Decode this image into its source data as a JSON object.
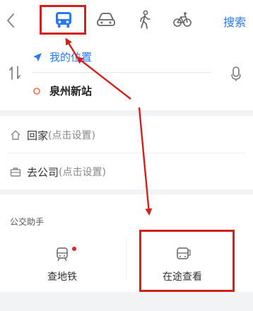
{
  "header": {
    "back_icon": "chevron-left-icon",
    "modes": [
      {
        "name": "bus",
        "icon": "bus-icon",
        "active": true
      },
      {
        "name": "car",
        "icon": "car-icon",
        "active": false
      },
      {
        "name": "walk",
        "icon": "walk-icon",
        "active": false
      },
      {
        "name": "bike",
        "icon": "bike-icon",
        "active": false
      }
    ],
    "search_label": "搜索"
  },
  "route": {
    "origin_label": "我的位置",
    "destination_label": "泉州新站",
    "swap_icon": "swap-icon",
    "voice_icon": "microphone-icon"
  },
  "quick": {
    "home_label": "回家",
    "home_hint": "(点击设置)",
    "work_label": "去公司",
    "work_hint": "(点击设置)"
  },
  "assistant": {
    "title": "公交助手",
    "subway_label": "查地铁",
    "bus_label": "在途查看",
    "subway_has_badge": true
  },
  "colors": {
    "accent": "#2b78f6",
    "annotation": "#d0221b",
    "badge": "#e0202a"
  }
}
